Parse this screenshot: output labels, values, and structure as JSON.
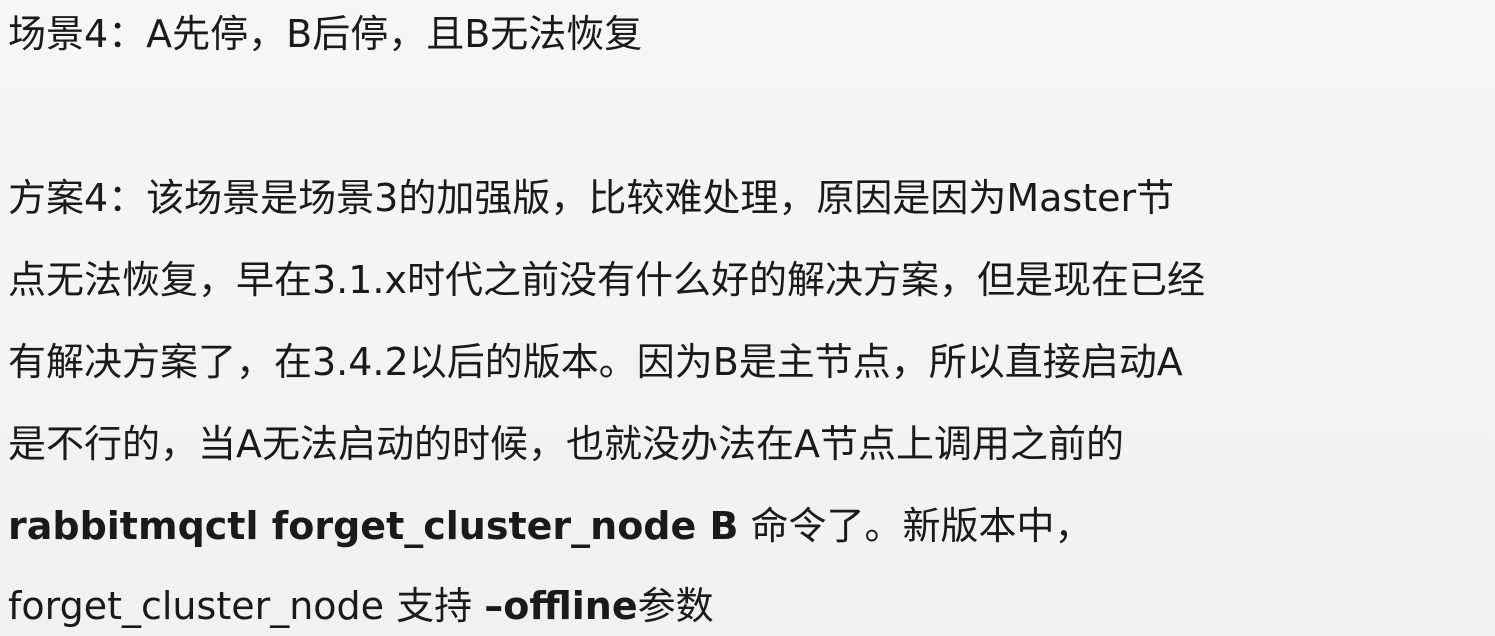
{
  "document": {
    "scenario_line": "场景4：A先停，B后停，且B无法恢复",
    "solution_lines": [
      "方案4：该场景是场景3的加强版，比较难处理，原因是因为Master节",
      "点无法恢复，早在3.1.x时代之前没有什么好的解决方案，但是现在已经",
      "有解决方案了，在3.4.2以后的版本。因为B是主节点，所以直接启动A",
      "是不行的，当A无法启动的时候，也就没办法在A节点上调用之前的"
    ],
    "command_line": {
      "command": "rabbitmqctl forget_cluster_node B",
      "suffix": " 命令了。新版本中，"
    },
    "last_line": {
      "prefix": "forget_cluster_node 支持 ",
      "flag": "–offline",
      "suffix": "参数"
    }
  }
}
